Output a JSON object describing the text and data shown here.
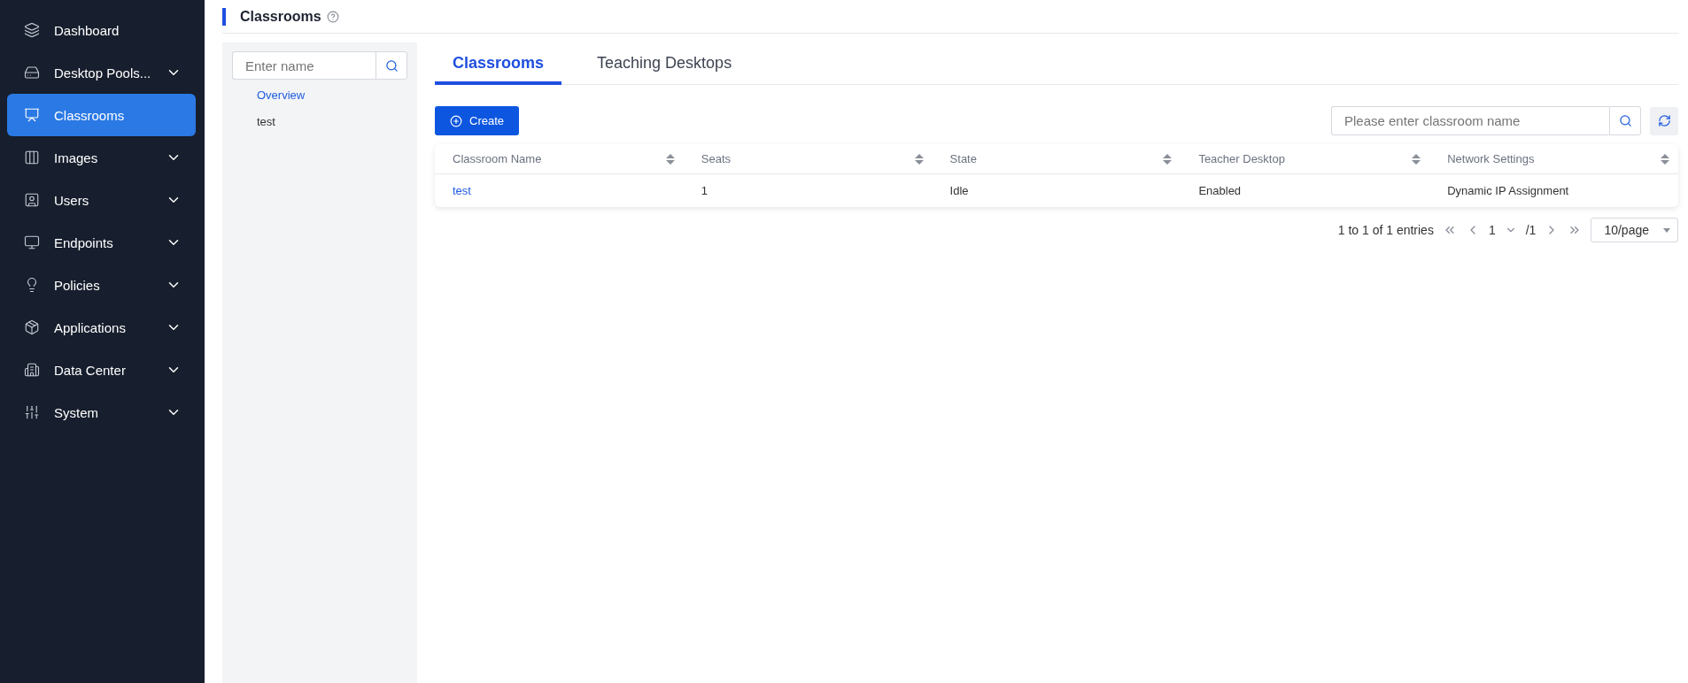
{
  "sidebar": {
    "items": [
      {
        "label": "Dashboard",
        "selected": false,
        "expandable": false
      },
      {
        "label": "Desktop Pools...",
        "selected": false,
        "expandable": true
      },
      {
        "label": "Classrooms",
        "selected": true,
        "expandable": false
      },
      {
        "label": "Images",
        "selected": false,
        "expandable": true
      },
      {
        "label": "Users",
        "selected": false,
        "expandable": true
      },
      {
        "label": "Endpoints",
        "selected": false,
        "expandable": true
      },
      {
        "label": "Policies",
        "selected": false,
        "expandable": true
      },
      {
        "label": "Applications",
        "selected": false,
        "expandable": true
      },
      {
        "label": "Data Center",
        "selected": false,
        "expandable": true
      },
      {
        "label": "System",
        "selected": false,
        "expandable": true
      }
    ]
  },
  "page": {
    "title": "Classrooms"
  },
  "tree": {
    "search": {
      "placeholder": "Enter name"
    },
    "items": [
      {
        "label": "Overview",
        "selected": true
      },
      {
        "label": "test",
        "selected": false
      }
    ]
  },
  "tabs": [
    {
      "label": "Classrooms",
      "selected": true
    },
    {
      "label": "Teaching Desktops",
      "selected": false
    }
  ],
  "toolbar": {
    "create": "Create",
    "search": {
      "placeholder": "Please enter classroom name"
    }
  },
  "table": {
    "columns": [
      "Classroom Name",
      "Seats",
      "State",
      "Teacher Desktop",
      "Network Settings"
    ],
    "rows": [
      [
        "test",
        "1",
        "Idle",
        "Enabled",
        "Dynamic IP Assignment"
      ]
    ]
  },
  "pagination": {
    "summary": "1 to 1 of 1 entries",
    "page": "1",
    "total": "/1",
    "page_size": "10/page"
  }
}
